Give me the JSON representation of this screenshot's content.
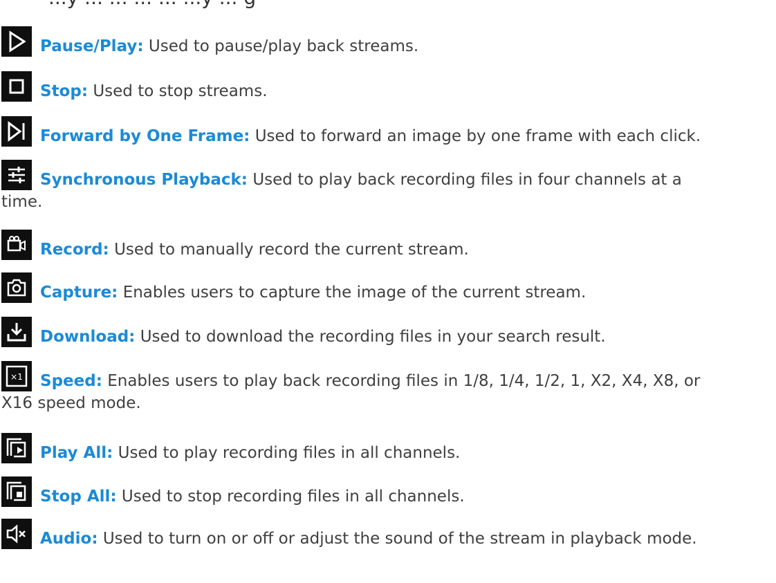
{
  "top_fragment": "...y ... ... ... ... ...y ... g",
  "colors": {
    "term": "#1b8ad6",
    "text": "#3f3f3f",
    "icon_bg": "#0f0f0f"
  },
  "entries": [
    {
      "icon": "play-icon",
      "term": "Pause/Play:",
      "desc": "Used to pause/play back streams.",
      "desc2": ""
    },
    {
      "icon": "stop-icon",
      "term": "Stop:",
      "desc": "Used to stop streams.",
      "desc2": ""
    },
    {
      "icon": "frame-forward-icon",
      "term": "Forward by One Frame:",
      "desc": "Used to forward an image by one frame with each click.",
      "desc2": ""
    },
    {
      "icon": "sliders-icon",
      "term": "Synchronous Playback:",
      "desc": "Used to play back recording files in four channels at a",
      "desc2": "time."
    },
    {
      "icon": "video-camera-icon",
      "term": "Record:",
      "desc": "Used to manually record the current stream.",
      "desc2": ""
    },
    {
      "icon": "camera-icon",
      "term": "Capture:",
      "desc": "Enables users to capture the image of the current stream.",
      "desc2": ""
    },
    {
      "icon": "download-icon",
      "term": "Download:",
      "desc": "Used to download the recording files in your search result.",
      "desc2": ""
    },
    {
      "icon": "speed-x1-icon",
      "term": "Speed:",
      "desc": "Enables users to play back recording files in 1/8, 1/4, 1/2, 1, X2, X4, X8, or",
      "desc2": "X16 speed mode."
    },
    {
      "icon": "play-all-icon",
      "term": "Play All:",
      "desc": "Used to play recording files in all channels.",
      "desc2": ""
    },
    {
      "icon": "stop-all-icon",
      "term": "Stop All:",
      "desc": "Used to stop recording files in all channels.",
      "desc2": ""
    },
    {
      "icon": "audio-mute-icon",
      "term": "Audio:",
      "desc": "Used to turn on or off or adjust the sound of the stream in playback mode.",
      "desc2": ""
    }
  ]
}
